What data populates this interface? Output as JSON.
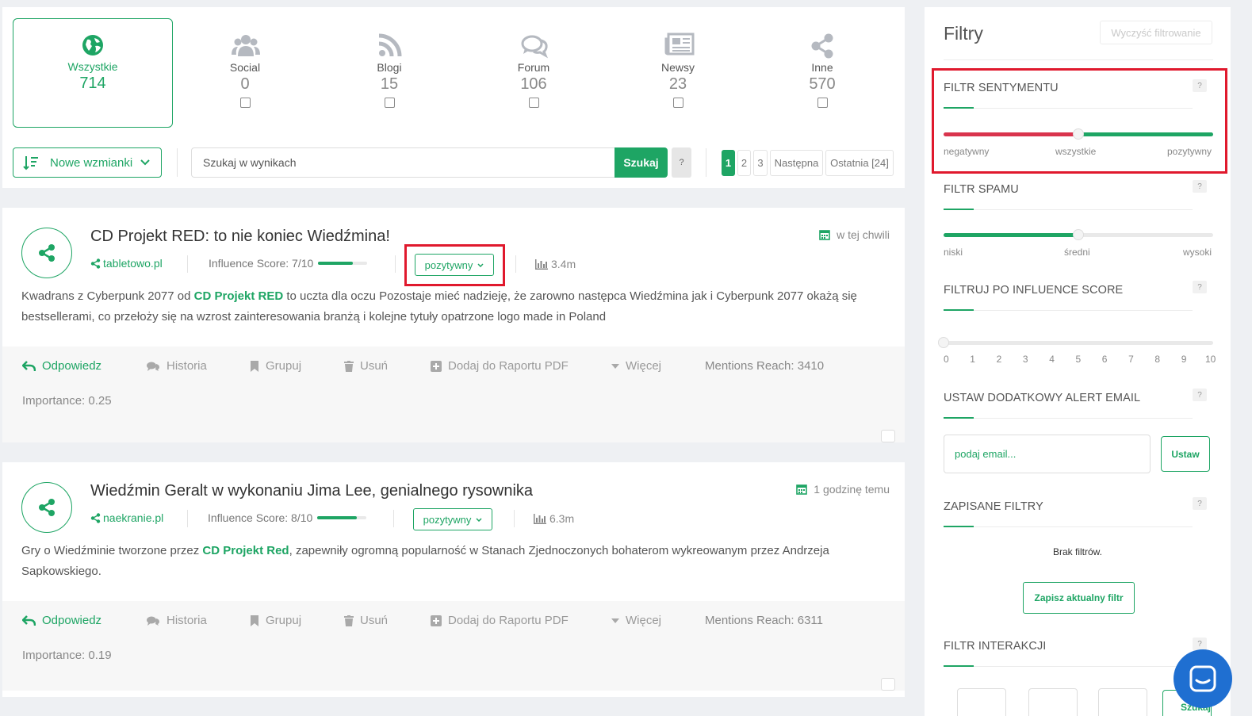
{
  "categories": [
    {
      "label": "Wszystkie",
      "count": "714",
      "icon": "globe-icon",
      "active": true
    },
    {
      "label": "Social",
      "count": "0",
      "icon": "users-icon"
    },
    {
      "label": "Blogi",
      "count": "15",
      "icon": "rss-icon"
    },
    {
      "label": "Forum",
      "count": "106",
      "icon": "comments-icon"
    },
    {
      "label": "Newsy",
      "count": "23",
      "icon": "newspaper-icon"
    },
    {
      "label": "Inne",
      "count": "570",
      "icon": "share-icon"
    }
  ],
  "toolbar": {
    "sort_label": "Nowe wzmianki",
    "search_placeholder": "Szukaj w wynikach",
    "search_button": "Szukaj",
    "help": "?",
    "pages": [
      "1",
      "2",
      "3"
    ],
    "next": "Następna",
    "last": "Ostatnia [24]"
  },
  "mentions": [
    {
      "title": "CD Projekt RED: to nie koniec Wiedźmina!",
      "time": "w tej chwili",
      "source": "tabletowo.pl",
      "influence": "Influence Score: 7/10",
      "influence_level": 0.7,
      "sentiment": "pozytywny",
      "reach": "3.4m",
      "body_before": "Kwadrans z Cyberpunk 2077 od ",
      "body_highlight": "CD Projekt RED",
      "body_after": " to uczta dla oczu Pozostaje mieć nadzieję, że zarowno następca Wiedźmina  jak i  Cyberpunk 2077 okażą się bestsellerami, co przełoży się na wzrost zainteresowania branżą i kolejne tytuły opatrzone logo made in Poland",
      "mentions_reach": "Mentions Reach: 3410",
      "importance": "Importance: 0.25"
    },
    {
      "title": "Wiedźmin Geralt w wykonaniu Jima Lee, genialnego rysownika",
      "time": "1 godzinę temu",
      "source": "naekranie.pl",
      "influence": "Influence Score: 8/10",
      "influence_level": 0.8,
      "sentiment": "pozytywny",
      "reach": "6.3m",
      "body_before": "Gry o Wiedźminie tworzone przez ",
      "body_highlight": "CD Projekt Red",
      "body_after": ", zapewniły ogromną popularność w Stanach Zjednoczonych bohaterom wykreowanym przez Andrzeja Sapkowskiego.",
      "mentions_reach": "Mentions Reach: 6311",
      "importance": "Importance: 0.19"
    }
  ],
  "actions": {
    "reply": "Odpowiedz",
    "history": "Historia",
    "group": "Grupuj",
    "delete": "Usuń",
    "add_pdf": "Dodaj do Raportu PDF",
    "more": "Więcej"
  },
  "sidebar": {
    "title": "Filtry",
    "clear": "Wyczyść filtrowanie",
    "help": "?",
    "sentiment": {
      "heading": "FILTR SENTYMENTU",
      "labels": [
        "negatywny",
        "wszystkie",
        "pozytywny"
      ],
      "value": 0.5
    },
    "spam": {
      "heading": "FILTR SPAMU",
      "labels": [
        "niski",
        "średni",
        "wysoki"
      ],
      "value": 0.5
    },
    "influence": {
      "heading": "FILTRUJ PO INFLUENCE SCORE",
      "ticks": [
        "0",
        "1",
        "2",
        "3",
        "4",
        "5",
        "6",
        "7",
        "8",
        "9",
        "10"
      ],
      "value": 0
    },
    "alert": {
      "heading": "USTAW DODATKOWY ALERT EMAIL",
      "placeholder": "podaj email...",
      "button": "Ustaw"
    },
    "saved": {
      "heading": "ZAPISANE FILTRY",
      "empty": "Brak filtrów.",
      "button": "Zapisz aktualny filtr"
    },
    "interactions": {
      "heading": "FILTR INTERAKCJI",
      "button": "Szukaj"
    }
  },
  "colors": {
    "accent": "#1ea564",
    "negative": "#d9344d",
    "highlight": "#e0192d",
    "chat": "#1f6fd1"
  }
}
